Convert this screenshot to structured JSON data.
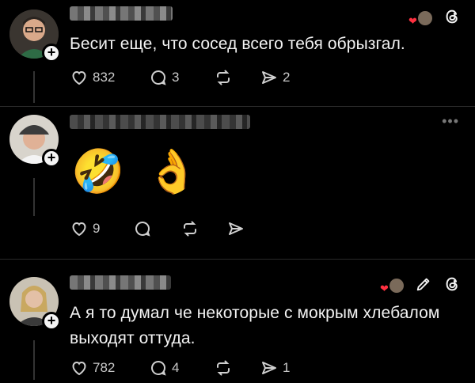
{
  "posts": [
    {
      "text": "Бесит еще, что сосед всего тебя обрызгал.",
      "likes": "832",
      "replies": "3",
      "shares": "2"
    },
    {
      "emoji": "🤣 👌",
      "likes": "9"
    },
    {
      "text_line1": "А я то думал че некоторые с мокрым хлебалом",
      "text_line2": "выходят оттуда.",
      "likes": "782",
      "replies": "4",
      "shares": "1"
    }
  ],
  "icons": {
    "threads_logo": "threads-logo-icon",
    "more": "more-dots-icon",
    "edit": "pencil-icon"
  },
  "colors": {
    "accent_heart": "#ff3040",
    "background": "#000000"
  }
}
